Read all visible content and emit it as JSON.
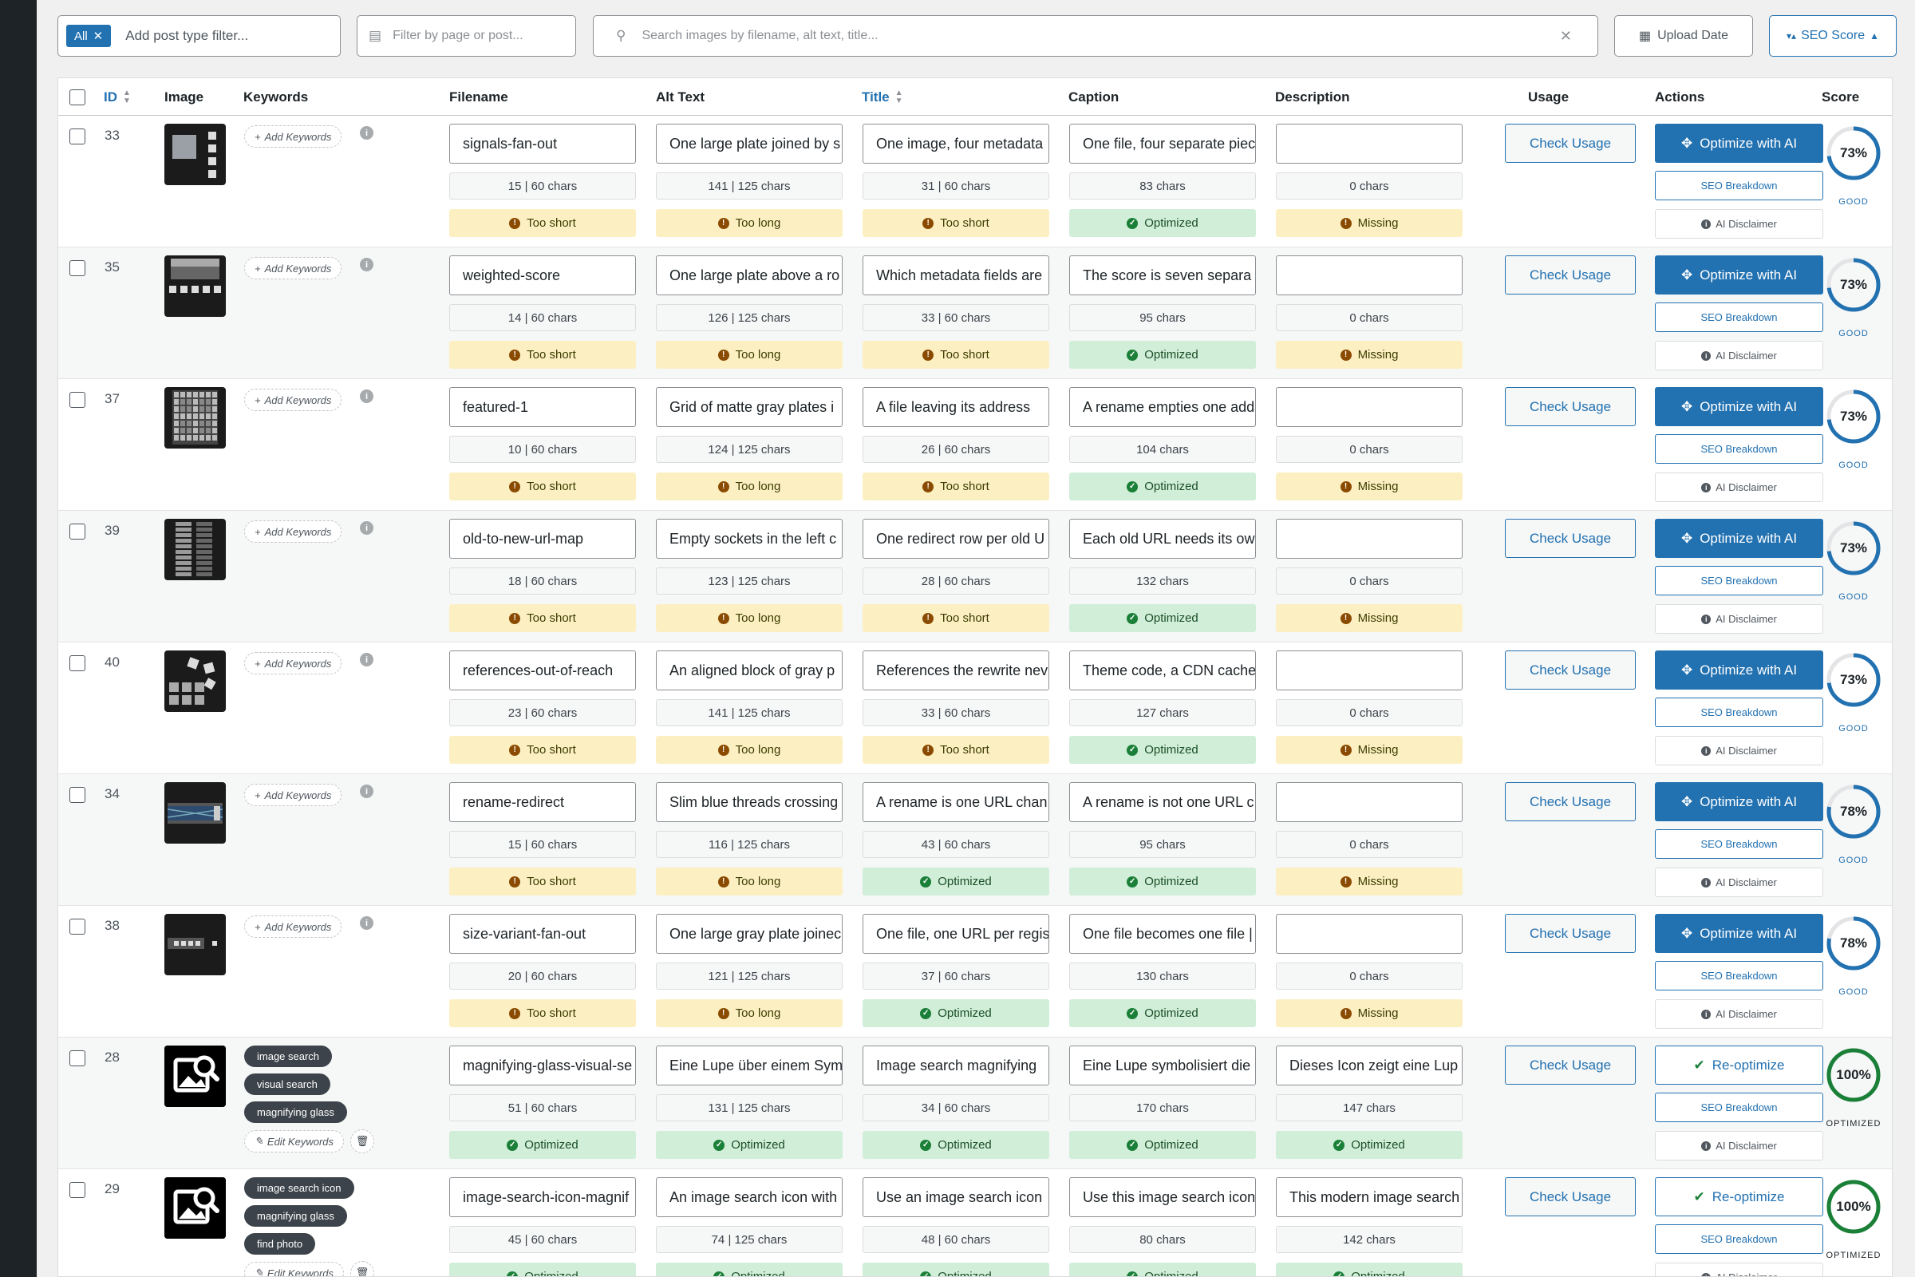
{
  "filters": {
    "post_type": {
      "chip": "All",
      "placeholder": "Add post type filter..."
    },
    "page": {
      "placeholder": "Filter by page or post..."
    },
    "search": {
      "placeholder": "Search images by filename, alt text, title..."
    },
    "upload_date": "Upload Date",
    "seo_score": "SEO Score"
  },
  "columns": {
    "id": "ID",
    "image": "Image",
    "keywords": "Keywords",
    "filename": "Filename",
    "alt": "Alt Text",
    "title": "Title",
    "caption": "Caption",
    "description": "Description",
    "usage": "Usage",
    "actions": "Actions",
    "score": "Score"
  },
  "labels": {
    "add_keywords": "Add Keywords",
    "edit_keywords": "Edit Keywords",
    "check_usage": "Check Usage",
    "optimize": "Optimize with AI",
    "reoptimize": "Re-optimize",
    "seo_breakdown": "SEO Breakdown",
    "ai_disclaimer": "AI Disclaimer"
  },
  "colors": {
    "accent": "#2271b1",
    "warn_bg": "#fcf0c3",
    "ok_bg": "#d1eed8",
    "score_good": "#2271b1",
    "score_optimized": "#1a7f37"
  },
  "rows": [
    {
      "id": "33",
      "thumb": "signals",
      "keywords": [],
      "filename": {
        "value": "signals-fan-out",
        "count": "15 | 60 chars",
        "status": "Too short",
        "state": "warn"
      },
      "alt": {
        "value": "One large plate joined by s",
        "count": "141 | 125 chars",
        "status": "Too long",
        "state": "warn"
      },
      "title": {
        "value": "One image, four metadata",
        "count": "31 | 60 chars",
        "status": "Too short",
        "state": "warn"
      },
      "caption": {
        "value": "One file, four separate piec",
        "count": "83 chars",
        "status": "Optimized",
        "state": "ok"
      },
      "description": {
        "value": "",
        "count": "0 chars",
        "status": "Missing",
        "state": "warn"
      },
      "action": "optimize",
      "score": {
        "value": "73%",
        "pct": 73,
        "label": "GOOD"
      }
    },
    {
      "id": "35",
      "thumb": "weighted",
      "keywords": [],
      "filename": {
        "value": "weighted-score",
        "count": "14 | 60 chars",
        "status": "Too short",
        "state": "warn"
      },
      "alt": {
        "value": "One large plate above a ro",
        "count": "126 | 125 chars",
        "status": "Too long",
        "state": "warn"
      },
      "title": {
        "value": "Which metadata fields are",
        "count": "33 | 60 chars",
        "status": "Too short",
        "state": "warn"
      },
      "caption": {
        "value": "The score is seven separa",
        "count": "95 chars",
        "status": "Optimized",
        "state": "ok"
      },
      "description": {
        "value": "",
        "count": "0 chars",
        "status": "Missing",
        "state": "warn"
      },
      "action": "optimize",
      "score": {
        "value": "73%",
        "pct": 73,
        "label": "GOOD"
      }
    },
    {
      "id": "37",
      "thumb": "grid",
      "keywords": [],
      "filename": {
        "value": "featured-1",
        "count": "10 | 60 chars",
        "status": "Too short",
        "state": "warn"
      },
      "alt": {
        "value": "Grid of matte gray plates i",
        "count": "124 | 125 chars",
        "status": "Too long",
        "state": "warn"
      },
      "title": {
        "value": "A file leaving its address",
        "count": "26 | 60 chars",
        "status": "Too short",
        "state": "warn"
      },
      "caption": {
        "value": "A rename empties one add",
        "count": "104 chars",
        "status": "Optimized",
        "state": "ok"
      },
      "description": {
        "value": "",
        "count": "0 chars",
        "status": "Missing",
        "state": "warn"
      },
      "action": "optimize",
      "score": {
        "value": "73%",
        "pct": 73,
        "label": "GOOD"
      }
    },
    {
      "id": "39",
      "thumb": "sockets",
      "keywords": [],
      "filename": {
        "value": "old-to-new-url-map",
        "count": "18 | 60 chars",
        "status": "Too short",
        "state": "warn"
      },
      "alt": {
        "value": "Empty sockets in the left c",
        "count": "123 | 125 chars",
        "status": "Too long",
        "state": "warn"
      },
      "title": {
        "value": "One redirect row per old U",
        "count": "28 | 60 chars",
        "status": "Too short",
        "state": "warn"
      },
      "caption": {
        "value": "Each old URL needs its ow",
        "count": "132 chars",
        "status": "Optimized",
        "state": "ok"
      },
      "description": {
        "value": "",
        "count": "0 chars",
        "status": "Missing",
        "state": "warn"
      },
      "action": "optimize",
      "score": {
        "value": "73%",
        "pct": 73,
        "label": "GOOD"
      }
    },
    {
      "id": "40",
      "thumb": "scatter",
      "keywords": [],
      "filename": {
        "value": "references-out-of-reach",
        "count": "23 | 60 chars",
        "status": "Too short",
        "state": "warn"
      },
      "alt": {
        "value": "An aligned block of gray p",
        "count": "141 | 125 chars",
        "status": "Too long",
        "state": "warn"
      },
      "title": {
        "value": "References the rewrite nev",
        "count": "33 | 60 chars",
        "status": "Too short",
        "state": "warn"
      },
      "caption": {
        "value": "Theme code, a CDN cache",
        "count": "127 chars",
        "status": "Optimized",
        "state": "ok"
      },
      "description": {
        "value": "",
        "count": "0 chars",
        "status": "Missing",
        "state": "warn"
      },
      "action": "optimize",
      "score": {
        "value": "73%",
        "pct": 73,
        "label": "GOOD"
      }
    },
    {
      "id": "34",
      "thumb": "threads",
      "keywords": [],
      "filename": {
        "value": "rename-redirect",
        "count": "15 | 60 chars",
        "status": "Too short",
        "state": "warn"
      },
      "alt": {
        "value": "Slim blue threads crossing",
        "count": "116 | 125 chars",
        "status": "Too long",
        "state": "warn"
      },
      "title": {
        "value": "A rename is one URL chan",
        "count": "43 | 60 chars",
        "status": "Optimized",
        "state": "ok"
      },
      "caption": {
        "value": "A rename is not one URL c",
        "count": "95 chars",
        "status": "Optimized",
        "state": "ok"
      },
      "description": {
        "value": "",
        "count": "0 chars",
        "status": "Missing",
        "state": "warn"
      },
      "action": "optimize",
      "score": {
        "value": "78%",
        "pct": 78,
        "label": "GOOD"
      }
    },
    {
      "id": "38",
      "thumb": "variant",
      "keywords": [],
      "filename": {
        "value": "size-variant-fan-out",
        "count": "20 | 60 chars",
        "status": "Too short",
        "state": "warn"
      },
      "alt": {
        "value": "One large gray plate joinec",
        "count": "121 | 125 chars",
        "status": "Too long",
        "state": "warn"
      },
      "title": {
        "value": "One file, one URL per regis",
        "count": "37 | 60 chars",
        "status": "Optimized",
        "state": "ok"
      },
      "caption": {
        "value": "One file becomes one file |",
        "count": "130 chars",
        "status": "Optimized",
        "state": "ok"
      },
      "description": {
        "value": "",
        "count": "0 chars",
        "status": "Missing",
        "state": "warn"
      },
      "action": "optimize",
      "score": {
        "value": "78%",
        "pct": 78,
        "label": "GOOD"
      }
    },
    {
      "id": "28",
      "thumb": "imagesearch",
      "keywords": [
        "image search",
        "visual search",
        "magnifying glass"
      ],
      "filename": {
        "value": "magnifying-glass-visual-se",
        "count": "51 | 60 chars",
        "status": "Optimized",
        "state": "ok"
      },
      "alt": {
        "value": "Eine Lupe über einem Sym",
        "count": "131 | 125 chars",
        "status": "Optimized",
        "state": "ok"
      },
      "title": {
        "value": "Image search magnifying",
        "count": "34 | 60 chars",
        "status": "Optimized",
        "state": "ok"
      },
      "caption": {
        "value": "Eine Lupe symbolisiert die",
        "count": "170 chars",
        "status": "Optimized",
        "state": "ok"
      },
      "description": {
        "value": "Dieses Icon zeigt eine Lup",
        "count": "147 chars",
        "status": "Optimized",
        "state": "ok"
      },
      "action": "reoptimize",
      "score": {
        "value": "100%",
        "pct": 100,
        "label": "OPTIMIZED"
      }
    },
    {
      "id": "29",
      "thumb": "imagesearch",
      "keywords": [
        "image search icon",
        "magnifying glass",
        "find photo"
      ],
      "filename": {
        "value": "image-search-icon-magnif",
        "count": "45 | 60 chars",
        "status": "Optimized",
        "state": "ok"
      },
      "alt": {
        "value": "An image search icon with",
        "count": "74 | 125 chars",
        "status": "Optimized",
        "state": "ok"
      },
      "title": {
        "value": "Use an image search icon",
        "count": "48 | 60 chars",
        "status": "Optimized",
        "state": "ok"
      },
      "caption": {
        "value": "Use this image search icon",
        "count": "80 chars",
        "status": "Optimized",
        "state": "ok"
      },
      "description": {
        "value": "This modern image search",
        "count": "142 chars",
        "status": "Optimized",
        "state": "ok"
      },
      "action": "reoptimize",
      "score": {
        "value": "100%",
        "pct": 100,
        "label": "OPTIMIZED"
      }
    }
  ]
}
